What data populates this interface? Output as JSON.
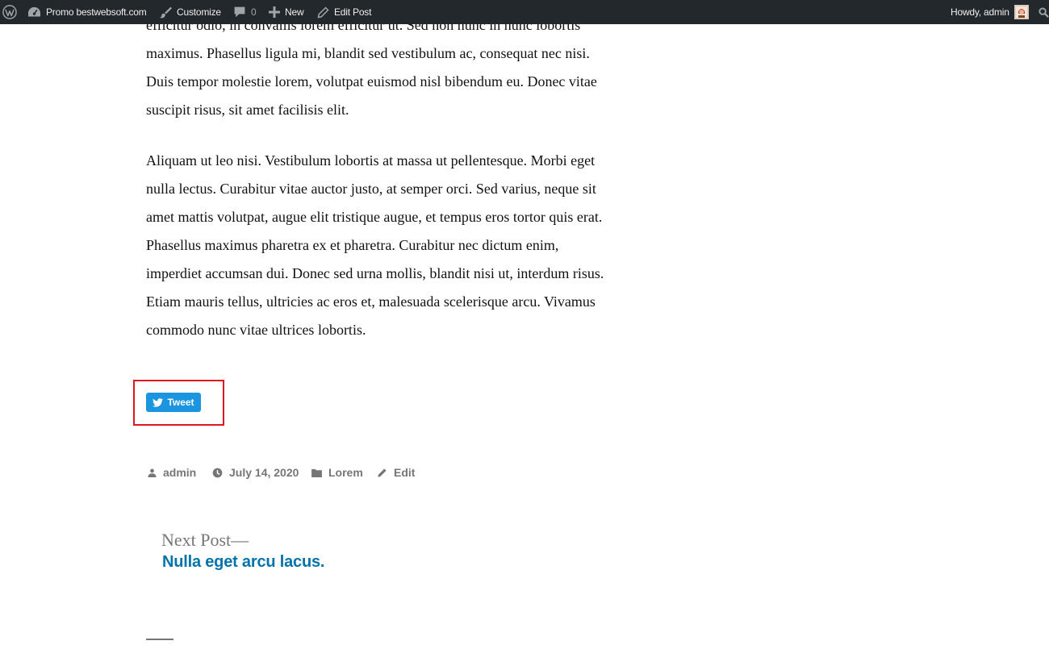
{
  "adminbar": {
    "site_name": "Promo bestwebsoft.com",
    "customize": "Customize",
    "comments_count": "0",
    "new": "New",
    "edit_post": "Edit Post",
    "greeting": "Howdy, admin"
  },
  "article": {
    "para1_lines": [
      "efficitur odio, in convallis lorem efficitur ut. Sed non nunc in nunc lobortis",
      "maximus. Phasellus ligula mi, blandit sed vestibulum ac, consequat nec nisi.",
      "Duis tempor molestie lorem, volutpat euismod nisl bibendum eu. Donec vitae",
      "suscipit risus, sit amet facilisis elit."
    ],
    "para2_lines": [
      "Aliquam ut leo nisi. Vestibulum lobortis at massa ut pellentesque. Morbi eget",
      "nulla lectus. Curabitur vitae auctor justo, at semper orci. Sed varius, neque sit",
      "amet mattis volutpat, augue elit tristique augue, et tempus eros tortor quis erat.",
      "Phasellus maximus pharetra ex et pharetra. Curabitur nec dictum enim,",
      "imperdiet accumsan dui. Donec sed urna mollis, blandit nisi ut, interdum risus.",
      "Etiam mauris tellus, ultricies ac eros et, malesuada scelerisque arcu. Vivamus",
      "commodo nunc vitae ultrices lobortis."
    ]
  },
  "tweet": {
    "label": "Tweet"
  },
  "meta": {
    "author": "admin",
    "date": "July 14, 2020",
    "category": "Lorem",
    "edit": "Edit"
  },
  "next_post": {
    "label": "Next Post—",
    "title": "Nulla eget arcu lacus."
  },
  "colors": {
    "adminbar_bg": "#23282d",
    "tweet_blue": "#1b95e0",
    "highlight_red": "#e0161e",
    "link_blue": "#0073aa",
    "meta_gray": "#767676"
  }
}
